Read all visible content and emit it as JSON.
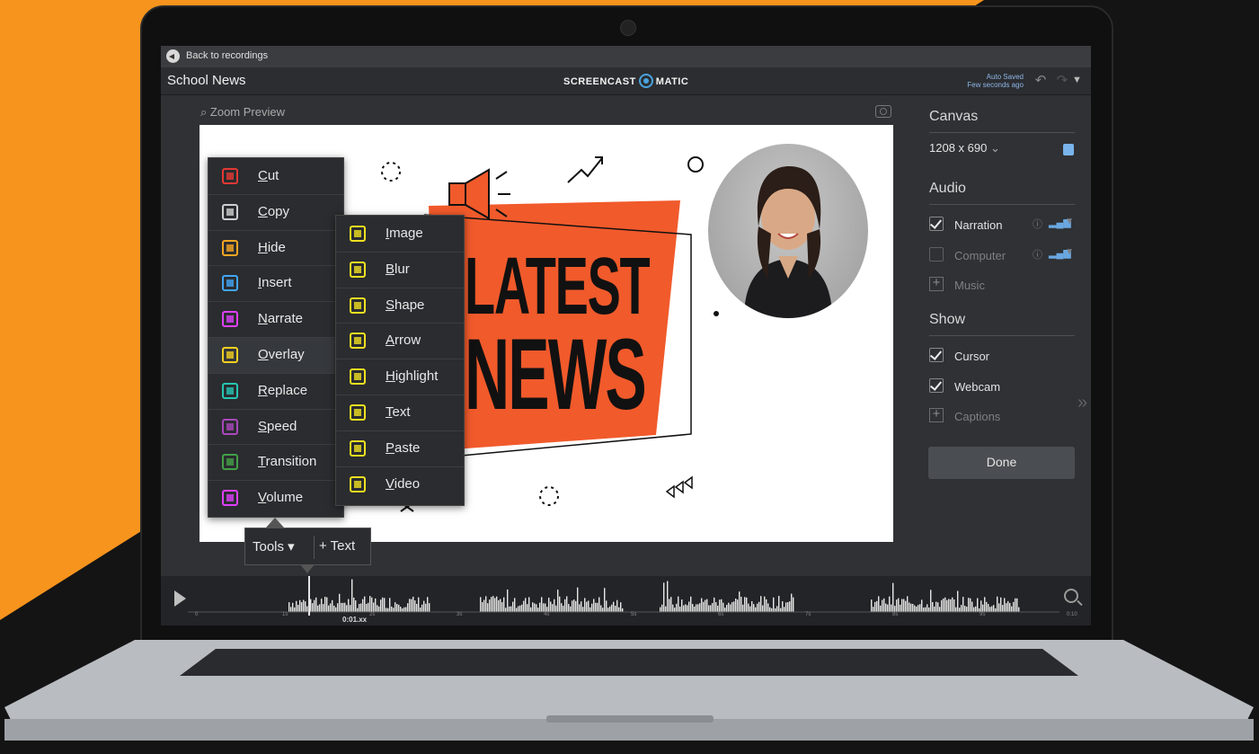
{
  "topbar": {
    "back_label": "Back to recordings"
  },
  "header": {
    "project_title": "School News",
    "logo_left": "SCREENCAST",
    "logo_right": "MATIC",
    "autosave_line1": "Auto Saved",
    "autosave_line2": "Few seconds ago"
  },
  "preview": {
    "zoom_label": "Zoom Preview"
  },
  "canvas": {
    "headline_line1": "LATEST",
    "headline_line2": "NEWS"
  },
  "tools_menu": {
    "items": [
      {
        "label": "Cut",
        "color": "#e53935"
      },
      {
        "label": "Copy",
        "color": "#cfcfcf"
      },
      {
        "label": "Hide",
        "color": "#f5a623"
      },
      {
        "label": "Insert",
        "color": "#42a5f5"
      },
      {
        "label": "Narrate",
        "color": "#e040fb"
      },
      {
        "label": "Overlay",
        "color": "#f5d020"
      },
      {
        "label": "Replace",
        "color": "#26c6b4"
      },
      {
        "label": "Speed",
        "color": "#ab47bc"
      },
      {
        "label": "Transition",
        "color": "#43a047"
      },
      {
        "label": "Volume",
        "color": "#e040fb"
      }
    ]
  },
  "overlay_menu": {
    "items": [
      {
        "label": "Image"
      },
      {
        "label": "Blur"
      },
      {
        "label": "Shape"
      },
      {
        "label": "Arrow"
      },
      {
        "label": "Highlight"
      },
      {
        "label": "Text"
      },
      {
        "label": "Paste"
      },
      {
        "label": "Video"
      }
    ],
    "icon_color": "#f0e020"
  },
  "toolbar": {
    "tools_label": "Tools ▾",
    "text_label": "+ Text"
  },
  "panel": {
    "canvas_heading": "Canvas",
    "canvas_size": "1208 x 690",
    "audio_heading": "Audio",
    "narration": "Narration",
    "computer": "Computer",
    "music": "Music",
    "show_heading": "Show",
    "cursor": "Cursor",
    "webcam": "Webcam",
    "captions": "Captions",
    "done": "Done",
    "accent": "#79b4ec"
  },
  "timeline": {
    "current_time": "0:01.xx",
    "tick_labels": [
      "0",
      "1s",
      "2s",
      "3s",
      "4s",
      "5s",
      "6s",
      "7s",
      "8s",
      "9s",
      "0:10"
    ]
  },
  "colors": {
    "orange": "#f7941d",
    "banner": "#f15a2b"
  }
}
